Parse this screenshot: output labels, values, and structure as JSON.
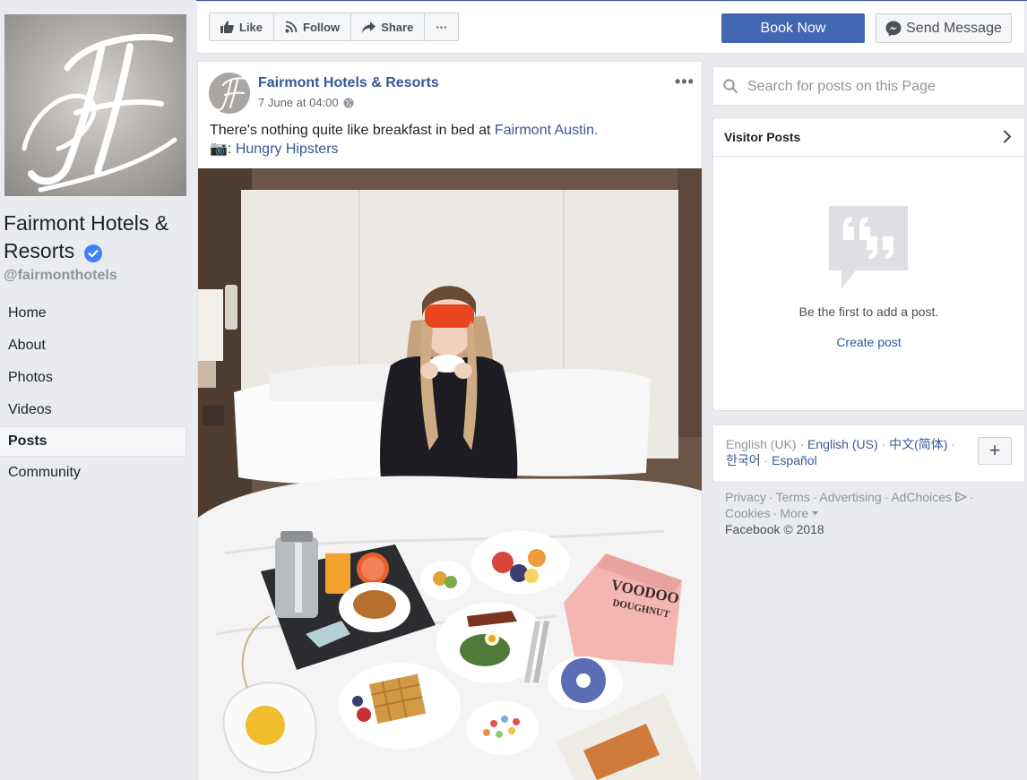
{
  "page": {
    "name": "Fairmont Hotels & Resorts",
    "handle": "@fairmonthotels"
  },
  "nav": [
    {
      "label": "Home"
    },
    {
      "label": "About"
    },
    {
      "label": "Photos"
    },
    {
      "label": "Videos"
    },
    {
      "label": "Posts",
      "active": true
    },
    {
      "label": "Community"
    }
  ],
  "actions": {
    "like": "Like",
    "follow": "Follow",
    "share": "Share",
    "more": "···",
    "book_now": "Book Now",
    "send_message": "Send Message"
  },
  "post": {
    "author": "Fairmont Hotels & Resorts",
    "timestamp": "7 June at 04:00",
    "text_prefix": "There's nothing quite like breakfast in bed at ",
    "location_link": "Fairmont Austin.",
    "camera_emoji": "📷",
    "credit_sep": ": ",
    "credit_link": "Hungry Hipsters",
    "menu": "•••",
    "box_text_1": "VOODOO",
    "box_text_2": "DOUGHNUT"
  },
  "search": {
    "placeholder": "Search for posts on this Page"
  },
  "visitor_posts": {
    "title": "Visitor Posts",
    "empty_text": "Be the first to add a post.",
    "create_label": "Create post"
  },
  "languages": {
    "current": "English (UK)",
    "options": [
      "English (US)",
      "中文(简体)",
      "한국어",
      "Español"
    ],
    "add": "+"
  },
  "footer": {
    "links": [
      "Privacy",
      "Terms",
      "Advertising",
      "AdChoices",
      "Cookies",
      "More"
    ],
    "copyright": "Facebook © 2018"
  },
  "colors": {
    "brand_blue": "#4267b2",
    "link_blue": "#365899",
    "background": "#e9ebee",
    "verified": "#4080ff"
  }
}
